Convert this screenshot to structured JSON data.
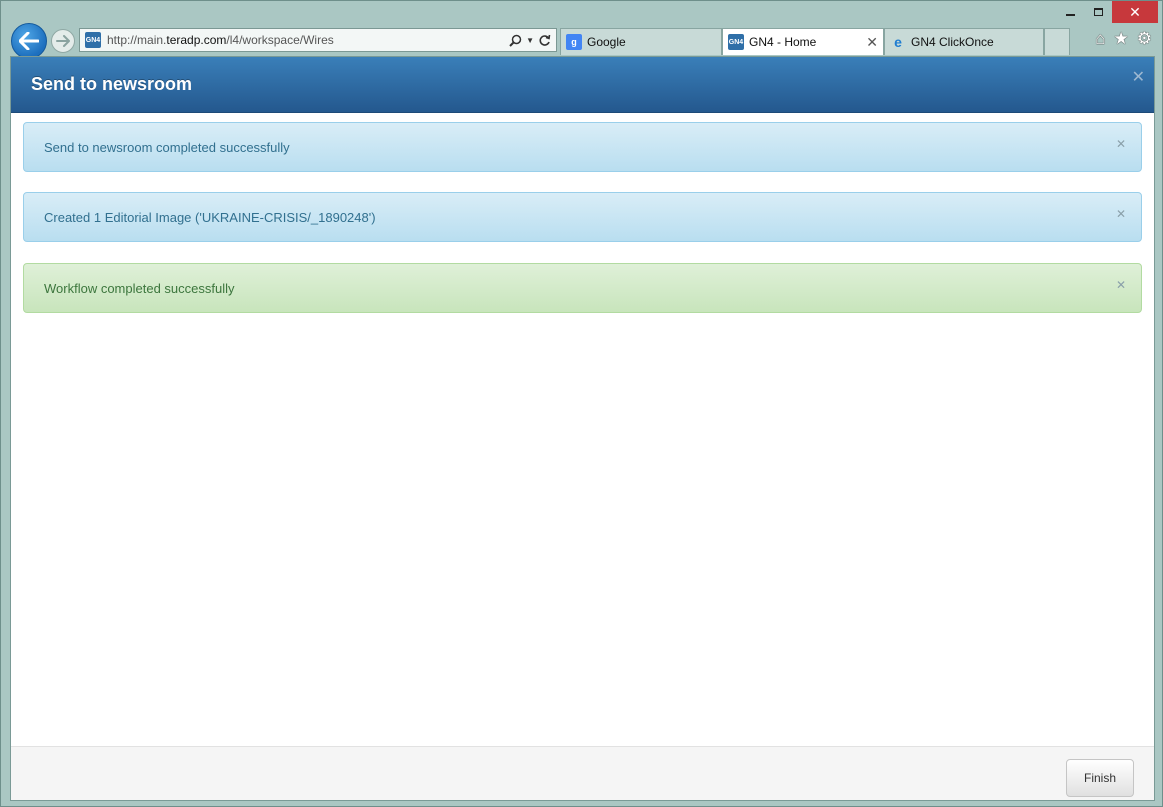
{
  "browser": {
    "url_prefix": "http://main.",
    "url_domain": "teradp.com",
    "url_path": "/l4/workspace/Wires",
    "site_icon_text": "GN4",
    "tabs": [
      {
        "label": "Google",
        "icon": "google-icon",
        "active": false
      },
      {
        "label": "GN4 - Home",
        "icon": "gn4-icon",
        "active": true
      },
      {
        "label": "GN4 ClickOnce",
        "icon": "ie-icon",
        "active": false
      }
    ]
  },
  "modal": {
    "title": "Send to newsroom",
    "alerts": [
      {
        "text": "Send to newsroom completed successfully",
        "type": "info"
      },
      {
        "text": "Created 1 Editorial Image ('UKRAINE-CRISIS/_1890248')",
        "type": "info"
      },
      {
        "text": "Workflow completed successfully",
        "type": "success"
      }
    ],
    "finish_label": "Finish"
  },
  "colors": {
    "header": "#2a6399",
    "info_bg": "#d9edf7",
    "success_bg": "#dff0d8",
    "close_button": "#c7383c"
  }
}
